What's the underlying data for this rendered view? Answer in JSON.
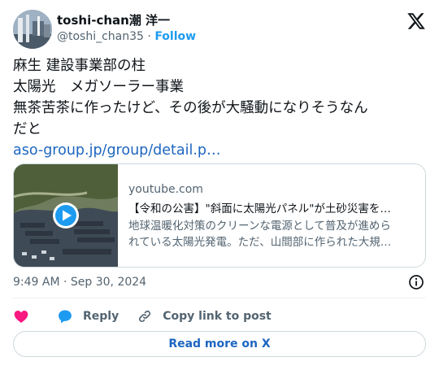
{
  "author": {
    "display_name": "toshi-chan潮 洋一",
    "handle": "@toshi_chan35",
    "separator": "·",
    "follow_label": "Follow"
  },
  "tweet": {
    "lines": [
      "麻生 建設事業部の柱",
      "太陽光　メガソーラー事業",
      "無茶苦茶に作ったけど、その後が大騒動になりそうなん",
      "だと"
    ],
    "link": "aso-group.jp/group/detail.p…"
  },
  "card": {
    "domain": "youtube.com",
    "title": "【令和の公害】\"斜面に太陽光パネル\"が土砂災害を…",
    "description_lines": [
      "地球温暖化対策のクリーンな電源として普及が進めら",
      "れている太陽光発電。ただ、山間部に作られた大規…"
    ]
  },
  "timestamp": "9:49 AM · Sep 30, 2024",
  "actions": {
    "reply_label": "Reply",
    "copy_link_label": "Copy link to post"
  },
  "read_more_label": "Read more on X",
  "colors": {
    "link": "#1d66c0",
    "follow": "#1d9bf0",
    "heart": "#f91880",
    "reply": "#1d9bf0",
    "muted": "#536471"
  }
}
